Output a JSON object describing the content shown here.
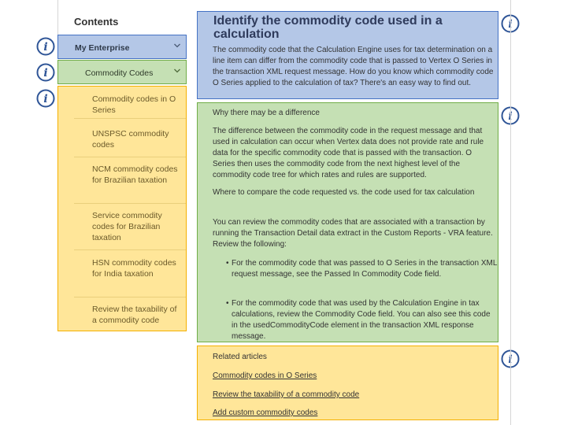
{
  "sidebar": {
    "title": "Contents",
    "enterprise": "My Enterprise",
    "commodity": "Commodity Codes",
    "items": [
      "Commodity codes in O Series",
      "UNSPSC commodity codes",
      "NCM commodity codes for Brazilian taxation",
      "Service commodity codes for Brazilian taxation",
      "HSN commodity codes for India taxation",
      "Review the taxability of a commodity code"
    ]
  },
  "article": {
    "title": "Identify the commodity code used in a calculation",
    "intro": "The commodity code that the Calculation Engine uses for tax determination on a line item can differ from the commodity code that is passed to Vertex O Series in the transaction XML request message. How do you know which commodity code O Series applied to the calculation of tax? There's an easy way to find out.",
    "why_heading": "Why there may be a difference",
    "why_text": "The difference between the commodity code in the request message and that used in calculation can occur when Vertex data does not provide rate and rule data for the specific commodity code that is passed with the transaction. O Series then uses the commodity code from the next highest level of the commodity code tree for which rates and rules are supported.",
    "compare_heading": "Where to compare the code requested vs. the code used for tax calculation",
    "review_text": "You can review the commodity codes that are associated with a transaction by running the Transaction Detail data extract in the Custom Reports - VRA feature. Review the following:",
    "bullets": [
      "For the commodity code that was passed to O Series in the transaction XML request message, see the Passed In Commodity Code field.",
      "For the commodity code that was used by the Calculation Engine in tax calculations, review the Commodity Code field. You can also see this code in the usedCommodityCode element in the transaction XML response message."
    ]
  },
  "related": {
    "title": "Related articles",
    "links": [
      "Commodity codes in O Series",
      "Review the taxability of a commodity code",
      "Add custom commodity codes"
    ]
  },
  "icons": {
    "info": "info-icon",
    "chevron": "chevron-down-icon"
  },
  "colors": {
    "blue_fill": "#b4c7e7",
    "blue_border": "#4472c4",
    "green_fill": "#c5e0b4",
    "green_border": "#70ad47",
    "yellow_fill": "#ffe699",
    "yellow_border": "#f4b000",
    "icon": "#2f5597"
  }
}
